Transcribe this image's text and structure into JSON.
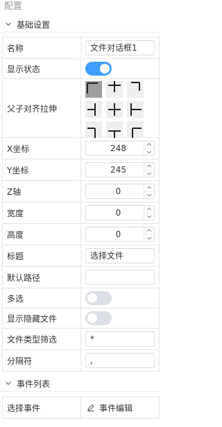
{
  "panel": {
    "title": "配置"
  },
  "basic": {
    "title": "基础设置",
    "name_label": "名称",
    "name_value": "文件对话框1",
    "visible_label": "显示状态",
    "visible_on": true,
    "anchor_label": "父子对齐拉伸",
    "x_label": "X坐标",
    "x_value": "248",
    "y_label": "Y坐标",
    "y_value": "245",
    "z_label": "Z轴",
    "z_value": "0",
    "width_label": "宽度",
    "width_value": "0",
    "height_label": "高度",
    "height_value": "0",
    "caption_label": "标题",
    "caption_value": "选择文件",
    "path_label": "默认路径",
    "path_value": "",
    "multi_label": "多选",
    "multi_on": false,
    "hidden_label": "显示隐藏文件",
    "hidden_on": false,
    "filter_label": "文件类型筛选",
    "filter_value": "*",
    "sep_label": "分隔符",
    "sep_value": ","
  },
  "events": {
    "title": "事件列表",
    "select_label": "选择事件",
    "edit_label": "事件编辑"
  },
  "colors": {
    "accent": "#409eff",
    "toggle_off": "#dcdfe6",
    "selected_cell": "#9e9e9e"
  }
}
